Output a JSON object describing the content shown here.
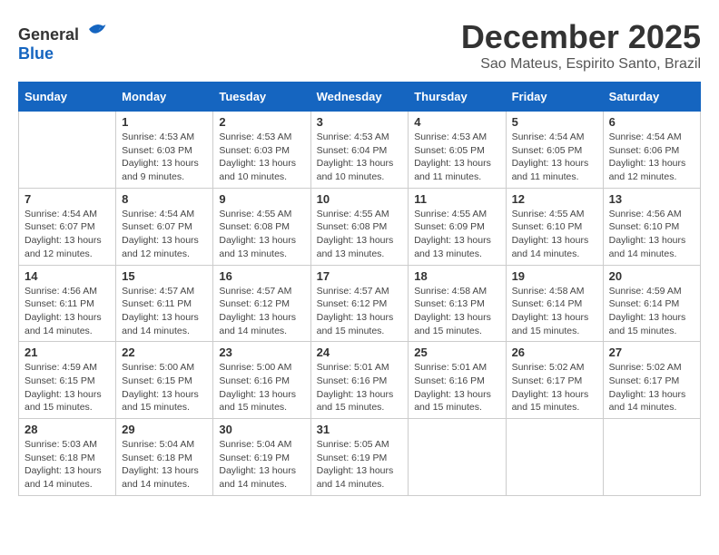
{
  "logo": {
    "general": "General",
    "blue": "Blue"
  },
  "header": {
    "month": "December 2025",
    "location": "Sao Mateus, Espirito Santo, Brazil"
  },
  "weekdays": [
    "Sunday",
    "Monday",
    "Tuesday",
    "Wednesday",
    "Thursday",
    "Friday",
    "Saturday"
  ],
  "weeks": [
    [
      {
        "day": "",
        "sunrise": "",
        "sunset": "",
        "daylight": ""
      },
      {
        "day": "1",
        "sunrise": "Sunrise: 4:53 AM",
        "sunset": "Sunset: 6:03 PM",
        "daylight": "Daylight: 13 hours and 9 minutes."
      },
      {
        "day": "2",
        "sunrise": "Sunrise: 4:53 AM",
        "sunset": "Sunset: 6:03 PM",
        "daylight": "Daylight: 13 hours and 10 minutes."
      },
      {
        "day": "3",
        "sunrise": "Sunrise: 4:53 AM",
        "sunset": "Sunset: 6:04 PM",
        "daylight": "Daylight: 13 hours and 10 minutes."
      },
      {
        "day": "4",
        "sunrise": "Sunrise: 4:53 AM",
        "sunset": "Sunset: 6:05 PM",
        "daylight": "Daylight: 13 hours and 11 minutes."
      },
      {
        "day": "5",
        "sunrise": "Sunrise: 4:54 AM",
        "sunset": "Sunset: 6:05 PM",
        "daylight": "Daylight: 13 hours and 11 minutes."
      },
      {
        "day": "6",
        "sunrise": "Sunrise: 4:54 AM",
        "sunset": "Sunset: 6:06 PM",
        "daylight": "Daylight: 13 hours and 12 minutes."
      }
    ],
    [
      {
        "day": "7",
        "sunrise": "Sunrise: 4:54 AM",
        "sunset": "Sunset: 6:07 PM",
        "daylight": "Daylight: 13 hours and 12 minutes."
      },
      {
        "day": "8",
        "sunrise": "Sunrise: 4:54 AM",
        "sunset": "Sunset: 6:07 PM",
        "daylight": "Daylight: 13 hours and 12 minutes."
      },
      {
        "day": "9",
        "sunrise": "Sunrise: 4:55 AM",
        "sunset": "Sunset: 6:08 PM",
        "daylight": "Daylight: 13 hours and 13 minutes."
      },
      {
        "day": "10",
        "sunrise": "Sunrise: 4:55 AM",
        "sunset": "Sunset: 6:08 PM",
        "daylight": "Daylight: 13 hours and 13 minutes."
      },
      {
        "day": "11",
        "sunrise": "Sunrise: 4:55 AM",
        "sunset": "Sunset: 6:09 PM",
        "daylight": "Daylight: 13 hours and 13 minutes."
      },
      {
        "day": "12",
        "sunrise": "Sunrise: 4:55 AM",
        "sunset": "Sunset: 6:10 PM",
        "daylight": "Daylight: 13 hours and 14 minutes."
      },
      {
        "day": "13",
        "sunrise": "Sunrise: 4:56 AM",
        "sunset": "Sunset: 6:10 PM",
        "daylight": "Daylight: 13 hours and 14 minutes."
      }
    ],
    [
      {
        "day": "14",
        "sunrise": "Sunrise: 4:56 AM",
        "sunset": "Sunset: 6:11 PM",
        "daylight": "Daylight: 13 hours and 14 minutes."
      },
      {
        "day": "15",
        "sunrise": "Sunrise: 4:57 AM",
        "sunset": "Sunset: 6:11 PM",
        "daylight": "Daylight: 13 hours and 14 minutes."
      },
      {
        "day": "16",
        "sunrise": "Sunrise: 4:57 AM",
        "sunset": "Sunset: 6:12 PM",
        "daylight": "Daylight: 13 hours and 14 minutes."
      },
      {
        "day": "17",
        "sunrise": "Sunrise: 4:57 AM",
        "sunset": "Sunset: 6:12 PM",
        "daylight": "Daylight: 13 hours and 15 minutes."
      },
      {
        "day": "18",
        "sunrise": "Sunrise: 4:58 AM",
        "sunset": "Sunset: 6:13 PM",
        "daylight": "Daylight: 13 hours and 15 minutes."
      },
      {
        "day": "19",
        "sunrise": "Sunrise: 4:58 AM",
        "sunset": "Sunset: 6:14 PM",
        "daylight": "Daylight: 13 hours and 15 minutes."
      },
      {
        "day": "20",
        "sunrise": "Sunrise: 4:59 AM",
        "sunset": "Sunset: 6:14 PM",
        "daylight": "Daylight: 13 hours and 15 minutes."
      }
    ],
    [
      {
        "day": "21",
        "sunrise": "Sunrise: 4:59 AM",
        "sunset": "Sunset: 6:15 PM",
        "daylight": "Daylight: 13 hours and 15 minutes."
      },
      {
        "day": "22",
        "sunrise": "Sunrise: 5:00 AM",
        "sunset": "Sunset: 6:15 PM",
        "daylight": "Daylight: 13 hours and 15 minutes."
      },
      {
        "day": "23",
        "sunrise": "Sunrise: 5:00 AM",
        "sunset": "Sunset: 6:16 PM",
        "daylight": "Daylight: 13 hours and 15 minutes."
      },
      {
        "day": "24",
        "sunrise": "Sunrise: 5:01 AM",
        "sunset": "Sunset: 6:16 PM",
        "daylight": "Daylight: 13 hours and 15 minutes."
      },
      {
        "day": "25",
        "sunrise": "Sunrise: 5:01 AM",
        "sunset": "Sunset: 6:16 PM",
        "daylight": "Daylight: 13 hours and 15 minutes."
      },
      {
        "day": "26",
        "sunrise": "Sunrise: 5:02 AM",
        "sunset": "Sunset: 6:17 PM",
        "daylight": "Daylight: 13 hours and 15 minutes."
      },
      {
        "day": "27",
        "sunrise": "Sunrise: 5:02 AM",
        "sunset": "Sunset: 6:17 PM",
        "daylight": "Daylight: 13 hours and 14 minutes."
      }
    ],
    [
      {
        "day": "28",
        "sunrise": "Sunrise: 5:03 AM",
        "sunset": "Sunset: 6:18 PM",
        "daylight": "Daylight: 13 hours and 14 minutes."
      },
      {
        "day": "29",
        "sunrise": "Sunrise: 5:04 AM",
        "sunset": "Sunset: 6:18 PM",
        "daylight": "Daylight: 13 hours and 14 minutes."
      },
      {
        "day": "30",
        "sunrise": "Sunrise: 5:04 AM",
        "sunset": "Sunset: 6:19 PM",
        "daylight": "Daylight: 13 hours and 14 minutes."
      },
      {
        "day": "31",
        "sunrise": "Sunrise: 5:05 AM",
        "sunset": "Sunset: 6:19 PM",
        "daylight": "Daylight: 13 hours and 14 minutes."
      },
      {
        "day": "",
        "sunrise": "",
        "sunset": "",
        "daylight": ""
      },
      {
        "day": "",
        "sunrise": "",
        "sunset": "",
        "daylight": ""
      },
      {
        "day": "",
        "sunrise": "",
        "sunset": "",
        "daylight": ""
      }
    ]
  ]
}
